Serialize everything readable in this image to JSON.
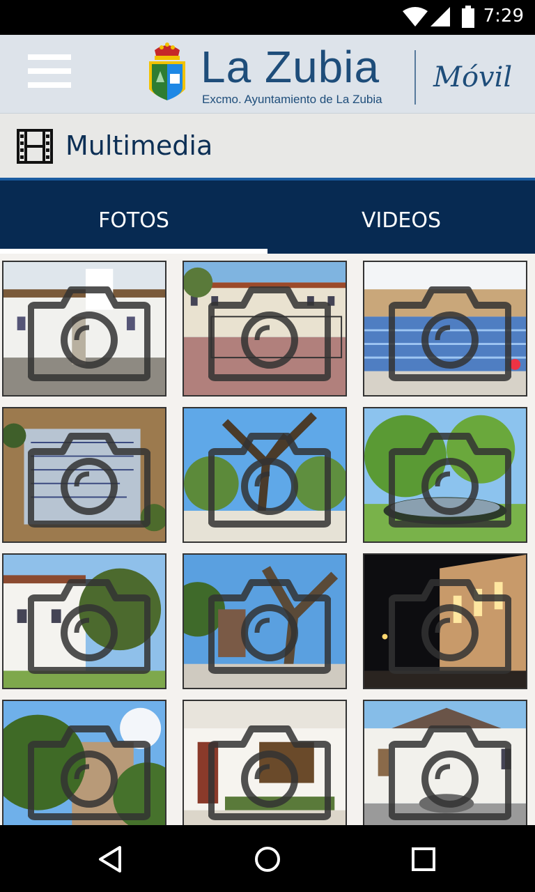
{
  "status_bar": {
    "time": "7:29"
  },
  "header": {
    "menu_icon": "hamburger-menu-icon",
    "logo_title": "La Zubia",
    "logo_subtitle": "Excmo. Ayuntamiento de La Zubia",
    "logo_tag": "Móvil",
    "colors": {
      "brand": "#1e4d7a",
      "background": "#dde3ea"
    }
  },
  "section": {
    "icon": "film-strip-icon",
    "title": "Multimedia"
  },
  "tabs": [
    {
      "label": "FOTOS",
      "active": true
    },
    {
      "label": "VIDEOS",
      "active": false
    }
  ],
  "gallery": {
    "overlay_icon": "camera-icon",
    "tiles": [
      {
        "name": "photo-plaza-fountain"
      },
      {
        "name": "photo-town-square"
      },
      {
        "name": "photo-indoor-pool"
      },
      {
        "name": "photo-stone-plaque"
      },
      {
        "name": "photo-old-tree-park"
      },
      {
        "name": "photo-garden-fountain"
      },
      {
        "name": "photo-white-house-tree"
      },
      {
        "name": "photo-tree-gazebo"
      },
      {
        "name": "photo-building-night"
      },
      {
        "name": "photo-church-trees"
      },
      {
        "name": "photo-chapel-interior"
      },
      {
        "name": "photo-courtyard-fountain"
      }
    ]
  },
  "nav_bar": {
    "back": "back-triangle-icon",
    "home": "home-circle-icon",
    "recents": "recents-square-icon"
  }
}
